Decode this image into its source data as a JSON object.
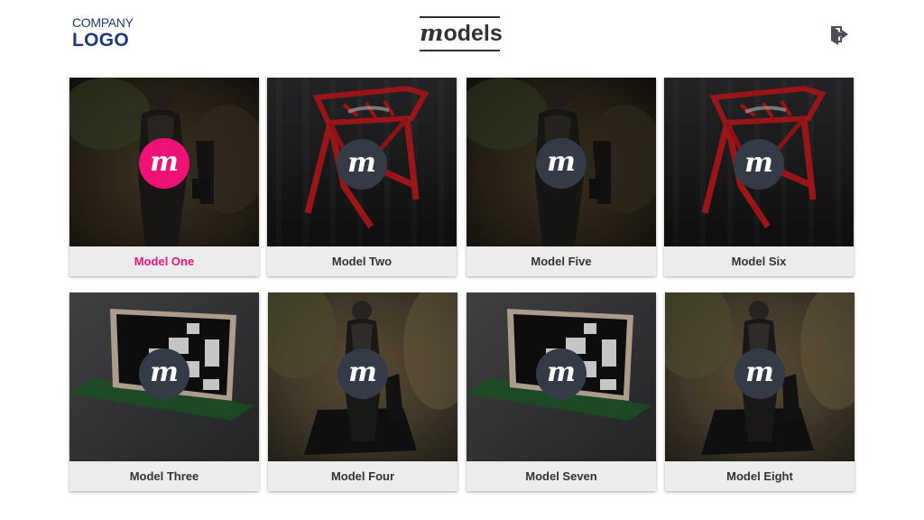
{
  "header": {
    "logo_line1": "COMPANY",
    "logo_line2": "LOGO",
    "title_initial": "m",
    "title_rest": "odels",
    "exit_icon": "sign-out-icon"
  },
  "badge_letter": "m",
  "colors": {
    "accent": "#e9157a",
    "badge": "#343b46",
    "logo": "#1f3a78",
    "card_label_bg": "#ececec"
  },
  "models": [
    {
      "label": "Model One",
      "thumbnail": "person",
      "selected": true
    },
    {
      "label": "Model Two",
      "thumbnail": "red-stool",
      "selected": false
    },
    {
      "label": "Model Five",
      "thumbnail": "person",
      "selected": false
    },
    {
      "label": "Model Six",
      "thumbnail": "red-stool",
      "selected": false
    },
    {
      "label": "Model Three",
      "thumbnail": "panel-board",
      "selected": false
    },
    {
      "label": "Model Four",
      "thumbnail": "standing-man",
      "selected": false
    },
    {
      "label": "Model Seven",
      "thumbnail": "panel-board",
      "selected": false
    },
    {
      "label": "Model Eight",
      "thumbnail": "standing-man",
      "selected": false
    }
  ]
}
